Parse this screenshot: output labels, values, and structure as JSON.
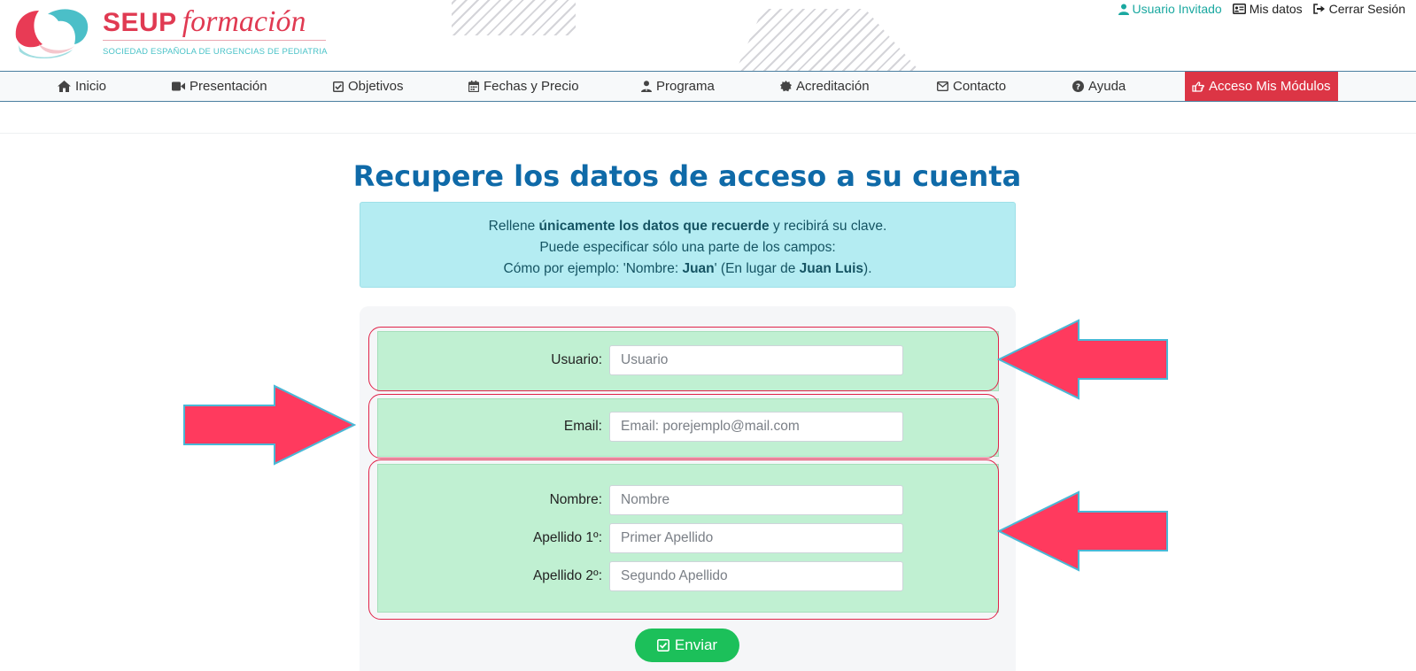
{
  "header": {
    "brand_main": "SEUP",
    "brand_script": "formación",
    "brand_subtitle": "SOCIEDAD ESPAÑOLA DE URGENCIAS DE PEDIATRIA",
    "user_links": [
      {
        "label": "Usuario Invitado",
        "icon": "user-icon"
      },
      {
        "label": "Mis datos",
        "icon": "id-card-icon"
      },
      {
        "label": "Cerrar Sesión",
        "icon": "sign-out-icon"
      }
    ]
  },
  "nav": {
    "items": [
      {
        "label": "Inicio",
        "icon": "home-icon"
      },
      {
        "label": "Presentación",
        "icon": "video-icon"
      },
      {
        "label": "Objetivos",
        "icon": "checkbox-icon"
      },
      {
        "label": "Fechas y Precio",
        "icon": "calendar-icon"
      },
      {
        "label": "Programa",
        "icon": "user-tie-icon"
      },
      {
        "label": "Acreditación",
        "icon": "certificate-icon"
      },
      {
        "label": "Contacto",
        "icon": "envelope-icon"
      },
      {
        "label": "Ayuda",
        "icon": "question-circle-icon"
      },
      {
        "label": "Acceso Mis Módulos",
        "icon": "hand-point-icon"
      }
    ]
  },
  "page": {
    "title": "Recupere los datos de acceso a su cuenta",
    "info": {
      "line1_pre": "Rellene ",
      "line1_bold": "únicamente los datos que recuerde",
      "line1_post": " y recibirá su clave.",
      "line2": "Puede especificar sólo una parte de los campos:",
      "line3_pre": "Cómo por ejemplo: 'Nombre: ",
      "line3_bold1": "Juan",
      "line3_mid": "' (En lugar de ",
      "line3_bold2": "Juan Luis",
      "line3_post": ")."
    }
  },
  "form": {
    "usuario": {
      "label": "Usuario:",
      "placeholder": "Usuario",
      "value": ""
    },
    "email": {
      "label": "Email:",
      "placeholder": "Email: porejemplo@mail.com",
      "value": ""
    },
    "nombre": {
      "label": "Nombre:",
      "placeholder": "Nombre",
      "value": ""
    },
    "apellido1": {
      "label": "Apellido 1º:",
      "placeholder": "Primer Apellido",
      "value": ""
    },
    "apellido2": {
      "label": "Apellido 2º:",
      "placeholder": "Segundo Apellido",
      "value": ""
    },
    "submit_label": "Enviar"
  },
  "colors": {
    "brand": "#e03a52",
    "title": "#0f6aa8",
    "section_bg": "#c0f0d2",
    "arrow": "#ff3a5e",
    "submit": "#1cc05a"
  }
}
